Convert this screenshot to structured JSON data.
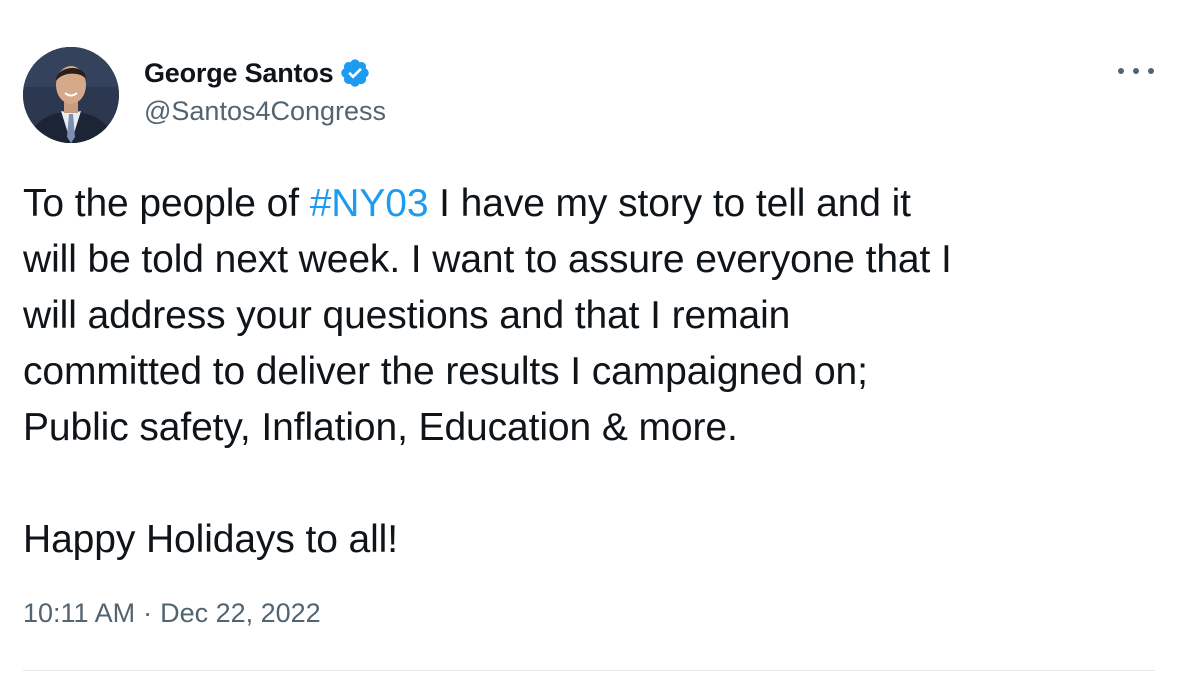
{
  "author": {
    "display_name": "George Santos",
    "handle": "@Santos4Congress",
    "verified_icon": "verified-badge-icon",
    "accent_color": "#1d9bf0"
  },
  "more_menu_icon": "more-horizontal-icon",
  "tweet": {
    "line1_before": "To the people of ",
    "hashtag": "#NY03",
    "line1_after": " I have my story to tell and it\nwill be told next week. I want to assure everyone that I\nwill address your questions and that I remain\ncommitted to deliver the results I campaigned on;\nPublic safety, Inflation, Education & more.\n\nHappy Holidays to all!"
  },
  "meta": {
    "time": "10:11 AM",
    "separator": "·",
    "date": "Dec 22, 2022"
  }
}
